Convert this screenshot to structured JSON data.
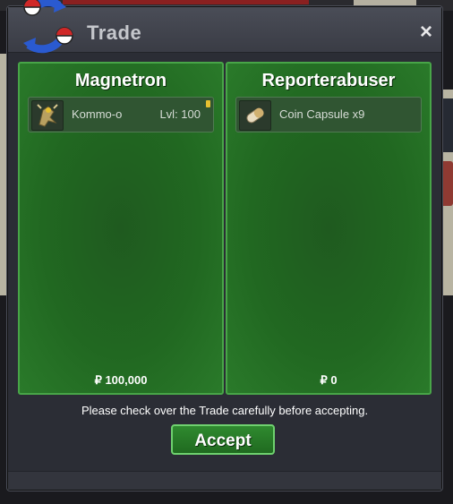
{
  "window": {
    "title": "Trade",
    "close_icon": "×",
    "logo_icon": "trade-arrows-icon"
  },
  "left_panel": {
    "player_name": "Magnetron",
    "item": {
      "icon": "kommo-o-sprite-icon",
      "name": "Kommo-o",
      "level": "Lvl: 100"
    },
    "money": "₽ 100,000"
  },
  "right_panel": {
    "player_name": "Reporterabuser",
    "item": {
      "icon": "coin-capsule-icon",
      "name": "Coin Capsule  x9"
    },
    "money": "₽ 0"
  },
  "notice": "Please check over the Trade carefully before accepting.",
  "accept_label": "Accept",
  "colors": {
    "panel_green": "#216821",
    "panel_border": "#48a548",
    "window_bg": "#2b2d35",
    "accent_red": "#d02828",
    "accent_blue": "#2a5ad0"
  }
}
